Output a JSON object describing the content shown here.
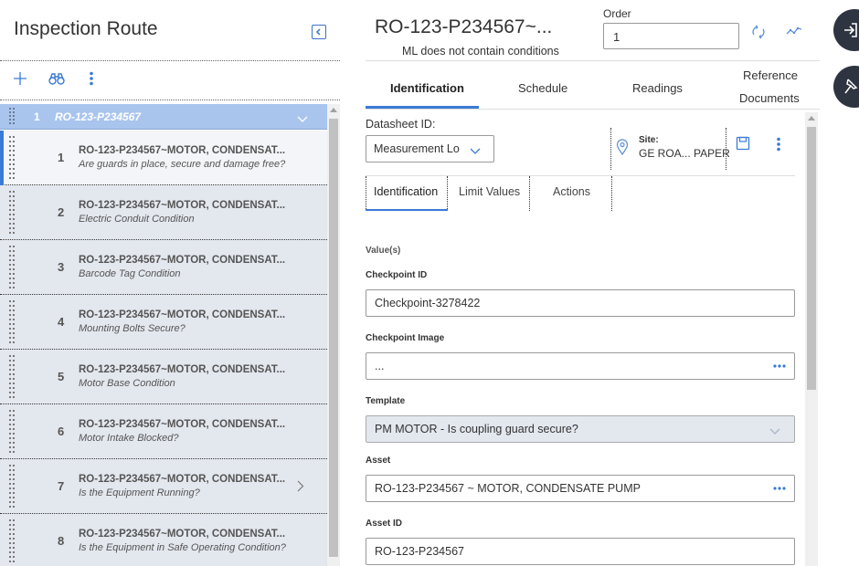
{
  "left_pane": {
    "title": "Inspection Route",
    "toolbar": {
      "add_icon": "plus-icon",
      "find_icon": "binoculars-icon",
      "more_icon": "vertical-ellipsis-icon"
    },
    "header_row": {
      "number": "1",
      "label": "RO-123-P234567"
    },
    "rows": [
      {
        "number": "1",
        "title": "RO-123-P234567~MOTOR, CONDENSAT...",
        "subtitle": "Are guards in place, secure and damage free?"
      },
      {
        "number": "2",
        "title": "RO-123-P234567~MOTOR, CONDENSAT...",
        "subtitle": "Electric Conduit Condition"
      },
      {
        "number": "3",
        "title": "RO-123-P234567~MOTOR, CONDENSAT...",
        "subtitle": "Barcode Tag Condition"
      },
      {
        "number": "4",
        "title": "RO-123-P234567~MOTOR, CONDENSAT...",
        "subtitle": "Mounting Bolts Secure?"
      },
      {
        "number": "5",
        "title": "RO-123-P234567~MOTOR, CONDENSAT...",
        "subtitle": "Motor Base Condition"
      },
      {
        "number": "6",
        "title": "RO-123-P234567~MOTOR, CONDENSAT...",
        "subtitle": "Motor Intake Blocked?"
      },
      {
        "number": "7",
        "title": "RO-123-P234567~MOTOR, CONDENSAT...",
        "subtitle": "Is the Equipment Running?"
      },
      {
        "number": "8",
        "title": "RO-123-P234567~MOTOR, CONDENSAT...",
        "subtitle": "Is the Equipment in Safe Operating Condition?"
      }
    ]
  },
  "right_pane": {
    "title": "RO-123-P234567~...",
    "subtitle": "ML does not contain conditions",
    "order_label": "Order",
    "order_value": "1",
    "tabs": [
      "Identification",
      "Schedule",
      "Readings",
      "Reference",
      "Documents"
    ],
    "datasheet_label": "Datasheet ID:",
    "datasheet_value": "Measurement Lo",
    "site_label": "Site:",
    "site_value": "GE ROA... PAPER",
    "sub_tabs": [
      "Identification",
      "Limit Values",
      "Actions"
    ],
    "section_label": "Value(s)",
    "fields": {
      "checkpoint_id": {
        "label": "Checkpoint ID",
        "value": "Checkpoint-3278422"
      },
      "checkpoint_image": {
        "label": "Checkpoint Image",
        "value": "..."
      },
      "template": {
        "label": "Template",
        "value": "PM MOTOR - Is coupling guard secure?"
      },
      "asset": {
        "label": "Asset",
        "value": "RO-123-P234567 ~ MOTOR, CONDENSATE PUMP"
      },
      "asset_id": {
        "label": "Asset ID",
        "value": "RO-123-P234567"
      }
    }
  },
  "colors": {
    "accent": "#3a7bd5",
    "selected_header": "#a9c5ee",
    "row_bg": "#e3e7ee",
    "fab_bg": "#2e3440"
  }
}
